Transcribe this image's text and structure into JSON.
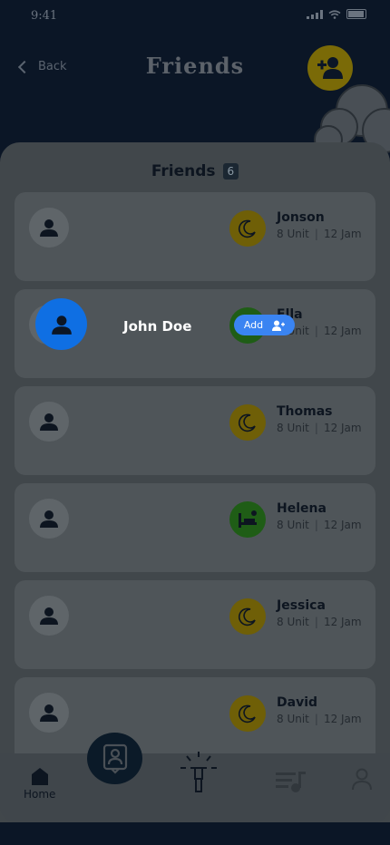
{
  "status_bar": {
    "time": "9:41"
  },
  "header": {
    "back_label": "Back",
    "title": "Friends"
  },
  "section": {
    "title": "Friends",
    "count": "6"
  },
  "friends": [
    {
      "name": "Jonson",
      "unit": "8 Unit",
      "time": "12 Jam",
      "status": "moon"
    },
    {
      "name": "Ella",
      "unit": "8 Unit",
      "time": "12 Jam",
      "status": "bed"
    },
    {
      "name": "Thomas",
      "unit": "8 Unit",
      "time": "12 Jam",
      "status": "moon"
    },
    {
      "name": "Helena",
      "unit": "8 Unit",
      "time": "12 Jam",
      "status": "bed"
    },
    {
      "name": "Jessica",
      "unit": "8 Unit",
      "time": "12 Jam",
      "status": "moon"
    },
    {
      "name": "David",
      "unit": "8 Unit",
      "time": "12 Jam",
      "status": "moon"
    }
  ],
  "suggestion": {
    "name": "John Doe",
    "add_label": "Add"
  },
  "nav": {
    "home_label": "Home"
  },
  "colors": {
    "accent_yellow": "#f4d10f",
    "accent_blue": "#3a84f2",
    "dark": "#0b1626"
  }
}
